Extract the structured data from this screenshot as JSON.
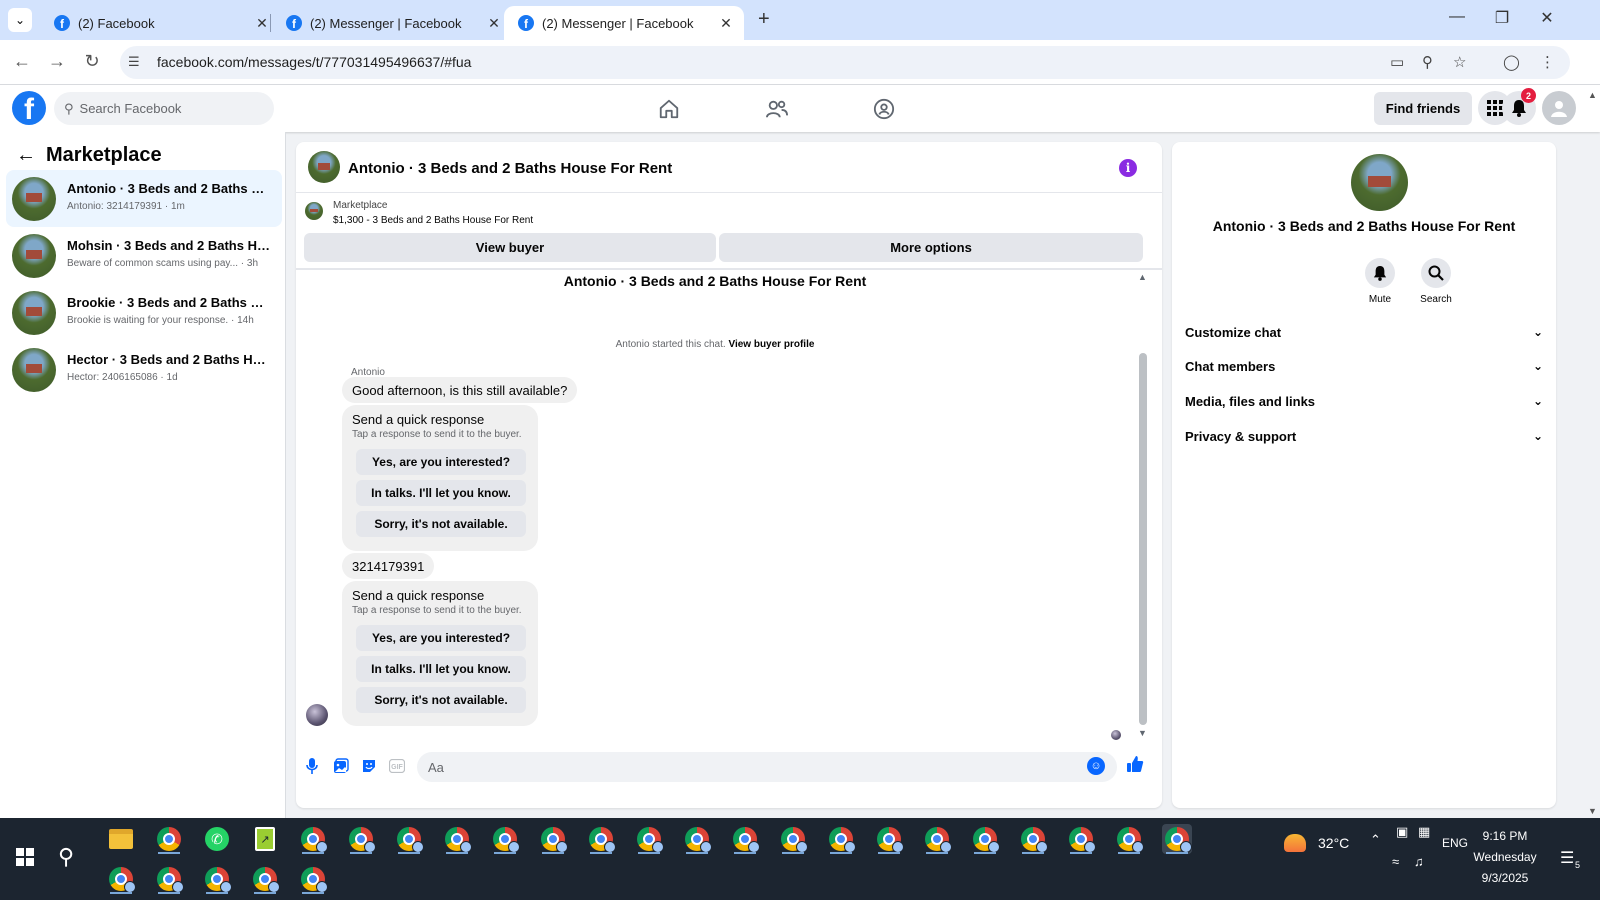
{
  "browser": {
    "tabs": [
      {
        "title": "(2) Facebook",
        "active": false
      },
      {
        "title": "(2) Messenger | Facebook",
        "active": false
      },
      {
        "title": "(2) Messenger | Facebook",
        "active": true
      }
    ],
    "url": "facebook.com/messages/t/777031495496637/#fua"
  },
  "fb_header": {
    "search_placeholder": "Search Facebook",
    "find_friends": "Find friends",
    "notification_count": "2"
  },
  "sidebar": {
    "title": "Marketplace",
    "conversations": [
      {
        "title": "Antonio · 3 Beds and 2 Baths House For Rent",
        "subtitle": "Antonio: 3214179391 · 1m",
        "selected": true
      },
      {
        "title": "Mohsin · 3 Beds and 2 Baths House For Rent",
        "subtitle": "Beware of common scams using pay... · 3h",
        "selected": false
      },
      {
        "title": "Brookie · 3 Beds and 2 Baths House For Rent",
        "subtitle": "Brookie is waiting for your response. · 14h",
        "selected": false
      },
      {
        "title": "Hector · 3 Beds and 2 Baths House For Rent",
        "subtitle": "Hector: 2406165086 · 1d",
        "selected": false
      }
    ]
  },
  "chat": {
    "header_title": "Antonio · 3 Beds and 2 Baths House For Rent",
    "marketplace_label": "Marketplace",
    "listing_summary": "$1,300 - 3 Beds and 2 Baths House For Rent",
    "view_buyer": "View buyer",
    "more_options": "More options",
    "listing_title": "Antonio · 3 Beds and 2 Baths House For Rent",
    "started_text": "Antonio started this chat.",
    "view_buyer_profile": "View buyer profile",
    "sender_name": "Antonio",
    "message_1": "Good afternoon, is this still available?",
    "message_2": "3214179391",
    "quick_response": {
      "title": "Send a quick response",
      "subtitle": "Tap a response to send it to the buyer.",
      "options": [
        "Yes, are you interested?",
        "In talks. I'll let you know.",
        "Sorry, it's not available."
      ]
    },
    "composer_placeholder": "Aa"
  },
  "info_panel": {
    "title": "Antonio · 3 Beds and 2 Baths House For Rent",
    "actions": [
      {
        "label": "Mute",
        "icon": "bell-icon"
      },
      {
        "label": "Search",
        "icon": "search-icon"
      }
    ],
    "sections": [
      "Customize chat",
      "Chat members",
      "Media, files and links",
      "Privacy & support"
    ]
  },
  "taskbar": {
    "weather": "32°C",
    "language": "ENG",
    "time": "9:16 PM",
    "day": "Wednesday",
    "date": "9/3/2025",
    "notification_count": "5"
  },
  "colors": {
    "facebook_blue": "#1877f2",
    "messenger_blue": "#0866ff",
    "info_purple": "#8a2be2",
    "selected_row": "#ebf5ff",
    "badge_red": "#e41e3f"
  }
}
